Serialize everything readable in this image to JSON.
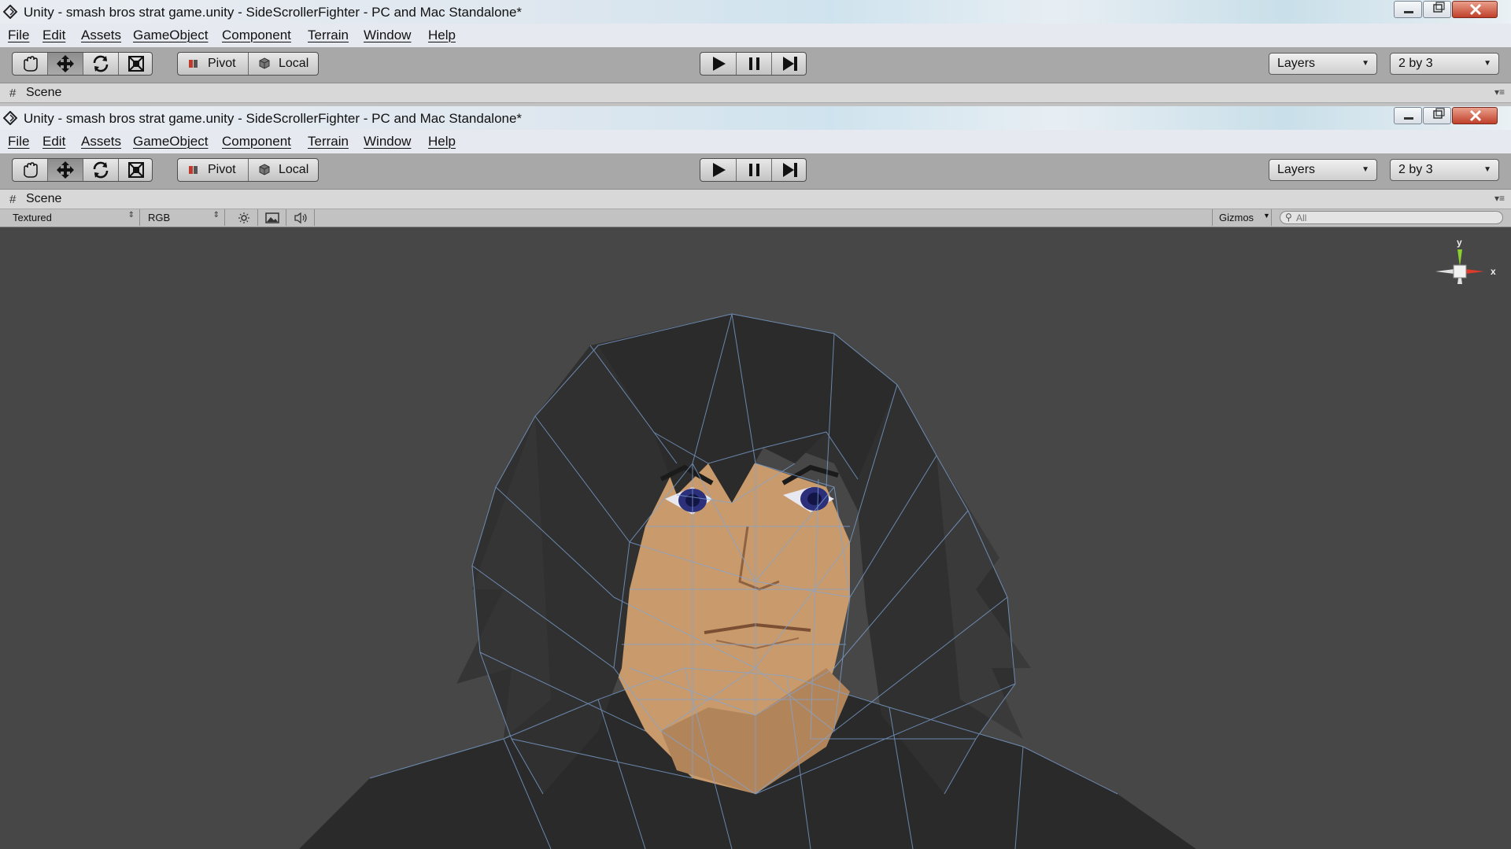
{
  "window": {
    "title": "Unity - smash bros strat game.unity - SideScrollerFighter - PC and Mac Standalone*"
  },
  "menu": [
    "File",
    "Edit",
    "Assets",
    "GameObject",
    "Component",
    "Terrain",
    "Window",
    "Help"
  ],
  "toolbar": {
    "tools": [
      "hand-icon",
      "move-icon",
      "rotate-icon",
      "scale-icon"
    ],
    "active_tool": "move-icon",
    "pivot_label": "Pivot",
    "local_label": "Local",
    "playback": [
      "play-icon",
      "pause-icon",
      "step-icon"
    ],
    "layers_label": "Layers",
    "layout_label": "2 by 3"
  },
  "scene": {
    "tab_label": "Scene",
    "render_mode": "Textured",
    "color_mode": "RGB",
    "gizmos_label": "Gizmos",
    "search_placeholder": "All",
    "axis_y": "y",
    "axis_x": "x"
  },
  "colors": {
    "viewport_bg": "#474747",
    "wire": "#7fa6d8",
    "hair": "#2f2f2f",
    "skin": "#c99a6b",
    "axis_y": "#8ccf2e",
    "axis_x": "#e03a2a"
  }
}
